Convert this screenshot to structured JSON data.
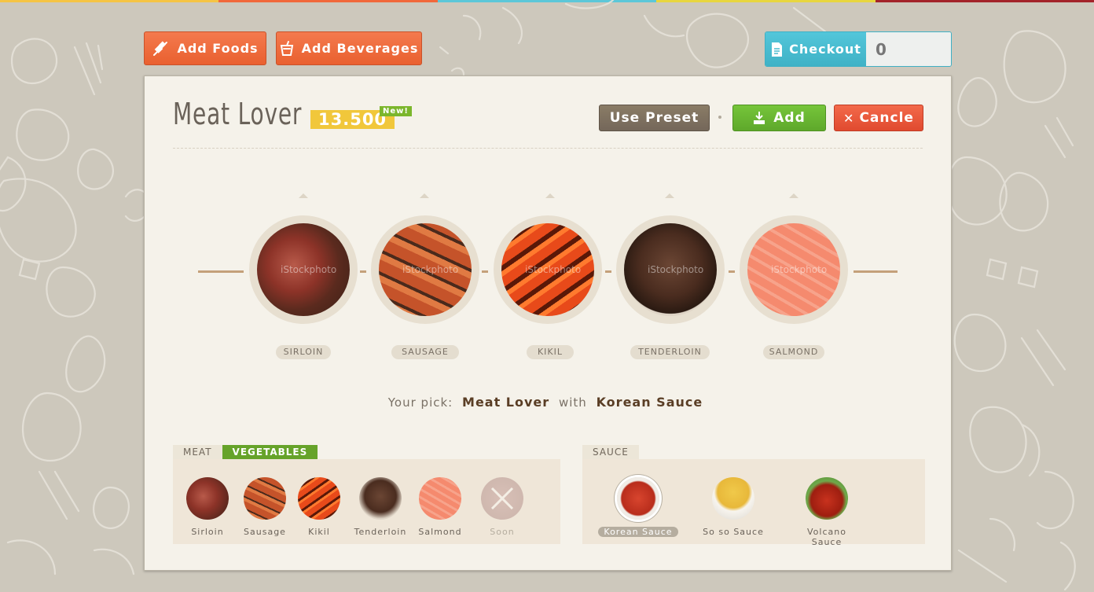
{
  "colors": {
    "stripe": [
      "#f5c445",
      "#f1683b",
      "#5cc7d8",
      "#e8d640",
      "#a3242a"
    ],
    "accent": "#f16a3f",
    "green": "#66a32a",
    "teal": "#4ec0d4"
  },
  "nav": {
    "add_foods": "Add Foods",
    "add_beverages": "Add Beverages",
    "checkout": "Checkout",
    "cart_count": "0"
  },
  "dish": {
    "title": "Meat Lover",
    "price": "13.500",
    "badge": "New!"
  },
  "actions": {
    "preset": "Use Preset",
    "add": "Add",
    "cancel": "Cancle"
  },
  "selection": [
    {
      "label": "SIRLOIN",
      "image": "sirloin-photo"
    },
    {
      "label": "SAUSAGE",
      "image": "sausage-photo"
    },
    {
      "label": "KIKIL",
      "image": "kikil-photo"
    },
    {
      "label": "TENDERLOIN",
      "image": "tenderloin-photo"
    },
    {
      "label": "SALMOND",
      "image": "salmon-photo"
    }
  ],
  "watermark": "iStockphoto",
  "pick": {
    "prefix": "Your pick:",
    "dish": "Meat Lover",
    "joiner": "with",
    "sauce": "Korean Sauce"
  },
  "ingredients": {
    "tabs": [
      "MEAT",
      "VEGETABLES"
    ],
    "active_tab": "VEGETABLES",
    "items": [
      "Sirloin",
      "Sausage",
      "Kikil",
      "Tenderloin",
      "Salmond",
      "Soon"
    ]
  },
  "sauce": {
    "tab": "SAUCE",
    "items": [
      "Korean Sauce",
      "So so Sauce",
      "Volcano Sauce"
    ],
    "selected": "Korean Sauce"
  }
}
